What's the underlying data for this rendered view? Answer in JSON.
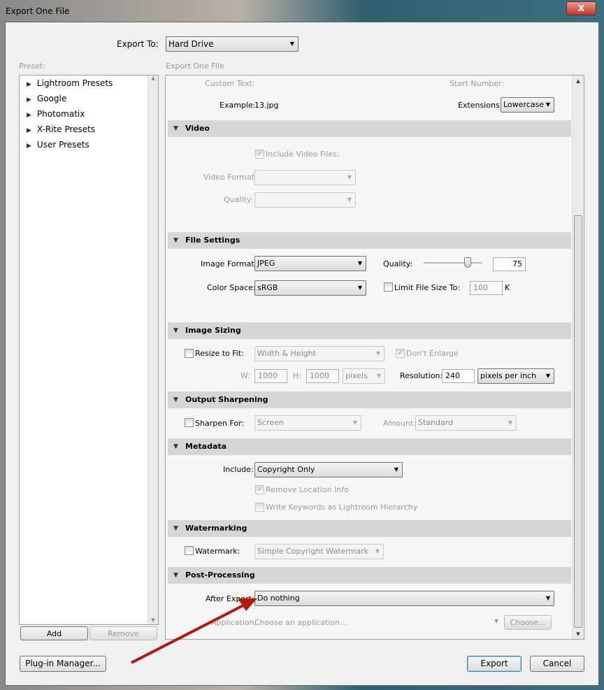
{
  "window": {
    "title": "Export One File",
    "close_label": "X"
  },
  "export_to": {
    "label": "Export To:",
    "value": "Hard Drive"
  },
  "preset": {
    "label": "Preset:",
    "items": [
      "Lightroom Presets",
      "Google",
      "Photomatix",
      "X-Rite Presets",
      "User Presets"
    ],
    "add_label": "Add",
    "remove_label": "Remove"
  },
  "panel_title": "Export One File",
  "naming": {
    "custom_text_label": "Custom Text:",
    "start_number_label": "Start Number:",
    "example_label": "Example:",
    "example_value": "13.jpg",
    "extensions_label": "Extensions:",
    "extensions_value": "Lowercase"
  },
  "video": {
    "title": "Video",
    "include_label": "Include Video Files:",
    "include_checked": true,
    "format_label": "Video Format:",
    "quality_label": "Quality:"
  },
  "file_settings": {
    "title": "File Settings",
    "format_label": "Image Format:",
    "format_value": "JPEG",
    "quality_label": "Quality:",
    "quality_value": "75",
    "quality_level": 75,
    "color_space_label": "Color Space:",
    "color_space_value": "sRGB",
    "limit_label": "Limit File Size To:",
    "limit_checked": false,
    "limit_value": "100",
    "limit_unit": "K"
  },
  "image_sizing": {
    "title": "Image Sizing",
    "resize_label": "Resize to Fit:",
    "resize_checked": false,
    "resize_mode": "Width & Height",
    "dont_enlarge_label": "Don't Enlarge",
    "w_label": "W:",
    "w_value": "1000",
    "h_label": "H:",
    "h_value": "1000",
    "unit": "pixels",
    "resolution_label": "Resolution:",
    "resolution_value": "240",
    "resolution_unit": "pixels per inch"
  },
  "output_sharpening": {
    "title": "Output Sharpening",
    "sharpen_label": "Sharpen For:",
    "sharpen_value": "Screen",
    "amount_label": "Amount:",
    "amount_value": "Standard"
  },
  "metadata": {
    "title": "Metadata",
    "include_label": "Include:",
    "include_value": "Copyright Only",
    "remove_location_label": "Remove Location Info",
    "write_keywords_label": "Write Keywords as Lightroom Hierarchy"
  },
  "watermarking": {
    "title": "Watermarking",
    "watermark_label": "Watermark:",
    "watermark_value": "Simple Copyright Watermark"
  },
  "post_processing": {
    "title": "Post-Processing",
    "after_export_label": "After Export:",
    "after_export_value": "Do nothing",
    "application_label": "Application:",
    "application_placeholder": "Choose an application...",
    "choose_label": "Choose..."
  },
  "footer": {
    "plugin_manager_label": "Plug-in Manager...",
    "export_label": "Export",
    "cancel_label": "Cancel"
  },
  "annotation": {
    "arrow_color": "#b5170f"
  }
}
